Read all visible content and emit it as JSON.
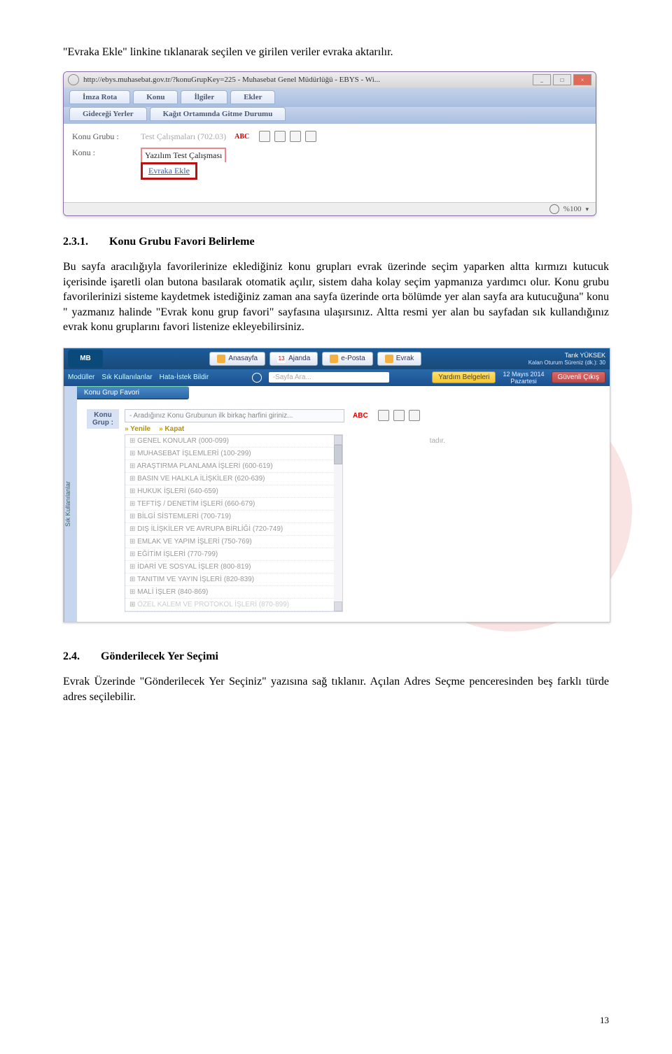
{
  "intro_text": "\"Evraka Ekle\" linkine tıklanarak seçilen ve girilen veriler evraka aktarılır.",
  "window1": {
    "url_title": "http://ebys.muhasebat.gov.tr/?konuGrupKey=225 - Muhasebat Genel Müdürlüğü - EBYS - Wi...",
    "tabs_row1": [
      "İmza Rota",
      "Konu",
      "İlgiler",
      "Ekler"
    ],
    "tabs_row2": [
      "Gideceği Yerler",
      "Kağıt Ortamında Gitme Durumu"
    ],
    "konu_grubu_label": "Konu Grubu :",
    "konu_grubu_value": "Test Çalışmaları (702.03)",
    "konu_label": "Konu :",
    "konu_value": "Yazılım Test Çalışması",
    "evraka_ekle": "Evraka Ekle",
    "abc": "ABC",
    "zoom": "%100",
    "win_min": "_",
    "win_max": "□",
    "win_close": "×"
  },
  "section231": {
    "num": "2.3.1.",
    "title": "Konu Grubu Favori Belirleme",
    "para": "Bu sayfa aracılığıyla favorilerinize eklediğiniz konu grupları evrak üzerinde seçim yaparken altta kırmızı kutucuk içerisinde işaretli olan butona basılarak otomatik açılır, sistem daha kolay seçim yapmanıza yardımcı olur. Konu grubu favorilerinizi sisteme kaydetmek istediğiniz zaman ana sayfa üzerinde orta bölümde yer alan sayfa ara kutucuğuna\" konu \" yazmanız halinde \"Evrak konu grup favori\" sayfasına ulaşırsınız. Altta resmi yer alan bu sayfadan sık kullandığınız evrak konu gruplarını favori listenize ekleyebilirsiniz."
  },
  "window2": {
    "logo": "MB",
    "top_buttons": [
      "Anasayfa",
      "Ajanda",
      "e-Posta",
      "Evrak"
    ],
    "cal_day": "13",
    "user_name": "Tarık YÜKSEK",
    "user_sub": "Kalan Oturum Süreniz (dk.): 30",
    "sub_items": [
      "Modüller",
      "Sık Kullanılanlar",
      "Hata-İstek Bildir"
    ],
    "search_placeholder": "-Sayfa Ara...",
    "help_label": "Yardım Belgeleri",
    "date_line1": "12 Mayıs 2014",
    "date_line2": "Pazartesi",
    "logout": "Güvenli Çıkış",
    "sidebar_label": "Sık Kullanılanlar",
    "crumb": "Konu Grup Favori",
    "panel_label": "Konu Grup :",
    "panel_placeholder": "- Aradığınız Konu Grubunun ilk birkaç harfini giriniz...",
    "panel_abc": "ABC",
    "list_yenile": "Yenile",
    "list_kapat": "Kapat",
    "tree": [
      "GENEL KONULAR (000-099)",
      "MUHASEBAT İŞLEMLERİ (100-299)",
      "ARAŞTIRMA PLANLAMA İŞLERİ (600-619)",
      "BASIN VE HALKLA İLİŞKİLER (620-639)",
      "HUKUK İŞLERİ (640-659)",
      "TEFTİŞ / DENETİM İŞLERİ (660-679)",
      "BİLGİ SİSTEMLERİ (700-719)",
      "DIŞ İLİŞKİLER VE AVRUPA BİRLİĞİ (720-749)",
      "EMLAK VE YAPIM İŞLERİ (750-769)",
      "EĞİTİM İŞLERİ (770-799)",
      "İDARİ VE SOSYAL İŞLER (800-819)",
      "TANITIM VE YAYIN İŞLERİ (820-839)",
      "MALİ İŞLER (840-869)",
      "ÖZEL KALEM VE PROTOKOL İŞLERİ (870-899)"
    ],
    "side_note": "tadır."
  },
  "section24": {
    "num": "2.4.",
    "title": "Gönderilecek Yer Seçimi",
    "para": "Evrak Üzerinde \"Gönderilecek Yer Seçiniz\" yazısına sağ tıklanır. Açılan Adres Seçme penceresinden beş farklı türde adres seçilebilir."
  },
  "page_number": "13"
}
